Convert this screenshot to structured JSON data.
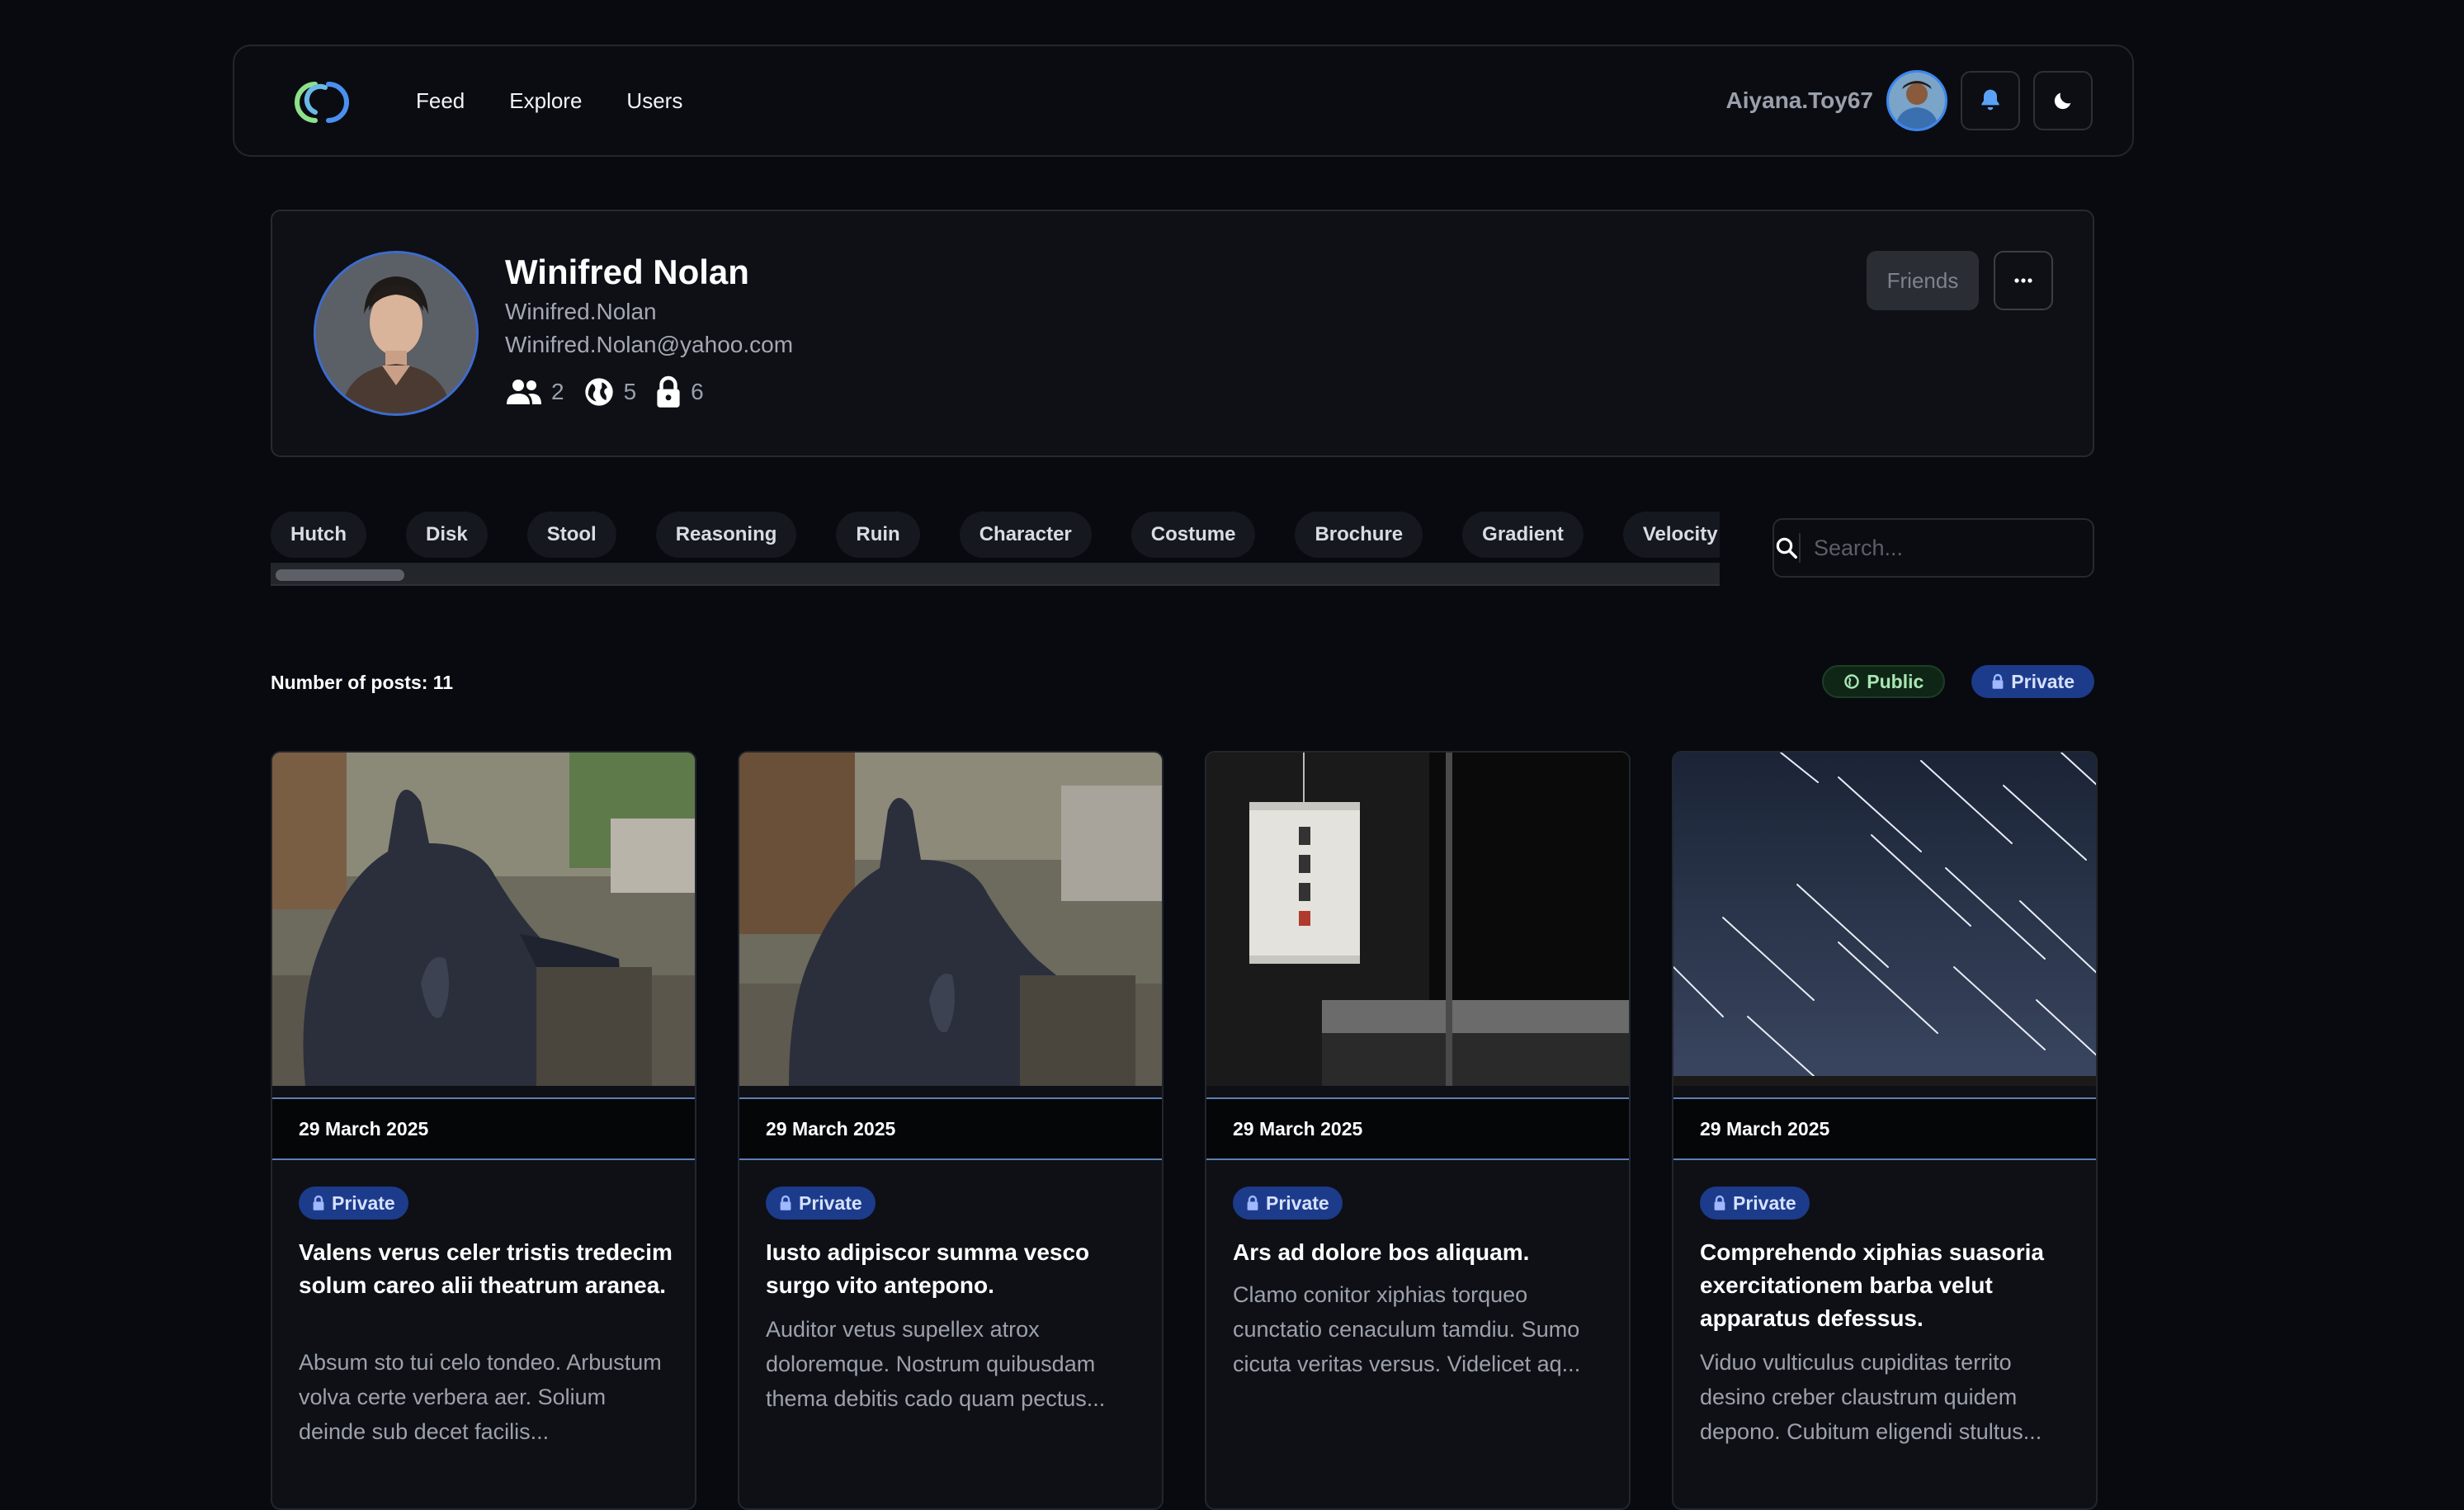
{
  "nav": {
    "links": [
      "Feed",
      "Explore",
      "Users"
    ],
    "username": "Aiyana.Toy67",
    "icons": [
      "logo-icon",
      "bell-icon",
      "moon-icon"
    ],
    "accent": "#3d86f0"
  },
  "profile": {
    "name": "Winifred Nolan",
    "username": "Winifred.Nolan",
    "email": "Winifred.Nolan@yahoo.com",
    "stats": {
      "friends": "2",
      "public": "5",
      "private": "6"
    },
    "friends_button": "Friends",
    "more_icon": "ellipsis-icon"
  },
  "tags": [
    "Hutch",
    "Disk",
    "Stool",
    "Reasoning",
    "Ruin",
    "Character",
    "Costume",
    "Brochure",
    "Gradient",
    "Velocity"
  ],
  "search": {
    "placeholder": "Search..."
  },
  "posts": {
    "count_label": "Number of posts: 11",
    "filters": {
      "public": "Public",
      "private": "Private"
    },
    "items": [
      {
        "date": "29 March 2025",
        "badge": "Private",
        "title": "Valens verus celer tristis tredecim solum careo alii theatrum aranea.",
        "body": "Absum sto tui celo tondeo. Arbustum volva certe verbera aer. Solium deinde sub decet facilis...",
        "image": "bronze-rabbit-statue"
      },
      {
        "date": "29 March 2025",
        "badge": "Private",
        "title": "Iusto adipiscor summa vesco surgo vito antepono.",
        "body": "Auditor vetus supellex atrox doloremque. Nostrum quibusdam thema debitis cado quam pectus...",
        "image": "bronze-rabbit-statue"
      },
      {
        "date": "29 March 2025",
        "badge": "Private",
        "title": "Ars ad dolore bos aliquam.",
        "body": "Clamo conitor xiphias torqueo cunctatio cenaculum tamdiu. Sumo cicuta veritas versus. Videlicet aq...",
        "image": "paper-lantern"
      },
      {
        "date": "29 March 2025",
        "badge": "Private",
        "title": "Comprehendo xiphias suasoria exercitationem barba velut apparatus defessus.",
        "body": "Viduo vulticulus cupiditas territo desino creber claustrum quidem depono. Cubitum eligendi stultus...",
        "image": "star-trails"
      }
    ]
  }
}
